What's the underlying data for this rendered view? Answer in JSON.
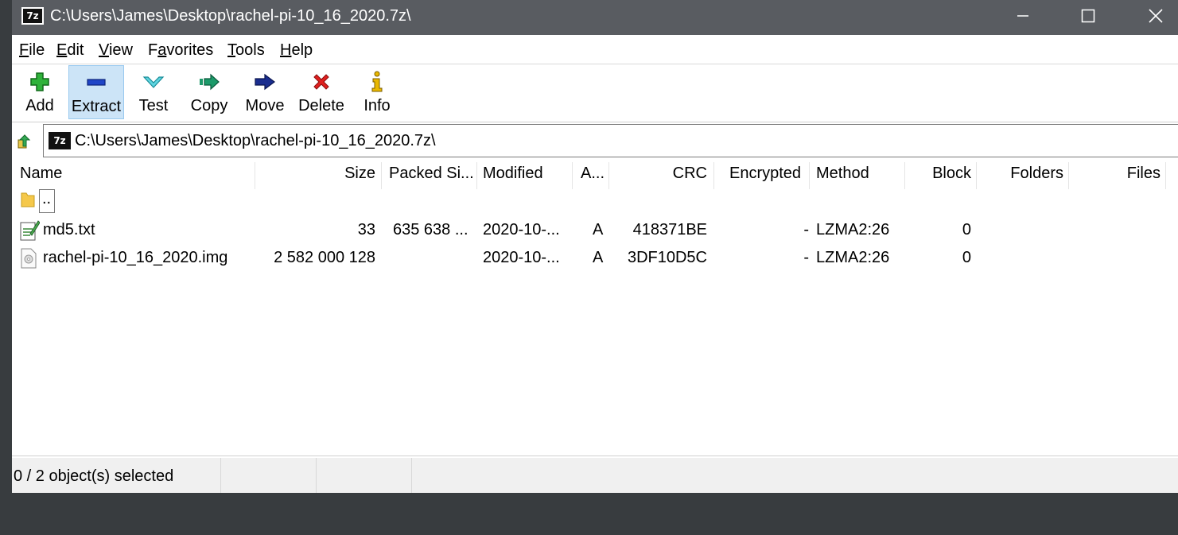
{
  "window": {
    "title": "C:\\Users\\James\\Desktop\\rachel-pi-10_16_2020.7z\\",
    "app_icon_text": "7z"
  },
  "menu": [
    {
      "label": "File",
      "key": "F",
      "rest": "ile"
    },
    {
      "label": "Edit",
      "key": "E",
      "rest": "dit"
    },
    {
      "label": "View",
      "key": "V",
      "rest": "iew"
    },
    {
      "label": "Favorites",
      "pre": "F",
      "key": "a",
      "rest": "vorites"
    },
    {
      "label": "Tools",
      "key": "T",
      "rest": "ools"
    },
    {
      "label": "Help",
      "key": "H",
      "rest": "elp"
    }
  ],
  "toolbar": {
    "add": "Add",
    "extract": "Extract",
    "test": "Test",
    "copy": "Copy",
    "move": "Move",
    "delete": "Delete",
    "info": "Info"
  },
  "address": {
    "path": "C:\\Users\\James\\Desktop\\rachel-pi-10_16_2020.7z\\",
    "icon_text": "7z"
  },
  "columns": {
    "name": "Name",
    "size": "Size",
    "packed": "Packed Si...",
    "modified": "Modified",
    "attributes": "A...",
    "crc": "CRC",
    "encrypted": "Encrypted",
    "method": "Method",
    "block": "Block",
    "folders": "Folders",
    "files": "Files"
  },
  "rows": [
    {
      "name": "..",
      "icon": "folder-up-icon"
    },
    {
      "name": "md5.txt",
      "icon": "text-file-icon",
      "size": "33",
      "packed": "635 638 ...",
      "modified": "2020-10-...",
      "attributes": "A",
      "crc": "418371BE",
      "encrypted": "-",
      "method": "LZMA2:26",
      "block": "0"
    },
    {
      "name": "rachel-pi-10_16_2020.img",
      "icon": "disk-image-icon",
      "size": "2 582 000 128",
      "packed": "",
      "modified": "2020-10-...",
      "attributes": "A",
      "crc": "3DF10D5C",
      "encrypted": "-",
      "method": "LZMA2:26",
      "block": "0"
    }
  ],
  "status": {
    "selection": "0 / 2 object(s) selected"
  },
  "colors": {
    "titlebar": "#595c61",
    "background": "#383c3f",
    "selected_tool": "#cce4f7"
  }
}
